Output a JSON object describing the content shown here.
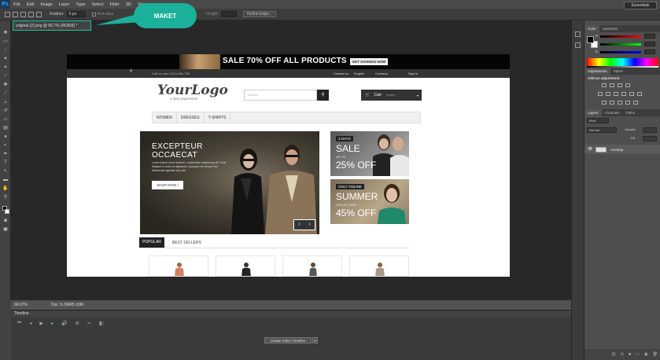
{
  "app": {
    "logo": "Ps"
  },
  "menu": [
    "File",
    "Edit",
    "Image",
    "Layer",
    "Type",
    "Select",
    "Filter",
    "3D",
    "View"
  ],
  "options": {
    "feather_label": "Feather:",
    "feather_value": "0 px",
    "antialias": "Anti-alias",
    "height_label": "Height:",
    "refine_button": "Refine Edge...",
    "workspace": "Essentials"
  },
  "document": {
    "tab_title": "original (2).png @ 66.7% (RGB/8) *",
    "zoom": "66.67%",
    "doc_size": "Doc: 5.29M/5.16M"
  },
  "annotation": {
    "label": "MAKET",
    "color": "#1ab09a"
  },
  "timeline": {
    "title": "Timeline",
    "create_button": "Create Video Timeline"
  },
  "panels": {
    "color_tabs": [
      "Color",
      "Swatches"
    ],
    "color_channels": [
      "R",
      "G",
      "B"
    ],
    "adjust_tabs": [
      "Adjustments",
      "Styles"
    ],
    "adjust_title": "Add an adjustment",
    "layer_tabs": [
      "Layers",
      "Channels",
      "Paths"
    ],
    "layer_kind": "Kind",
    "blend_mode": "Normal",
    "opacity_label": "Opacity:",
    "fill_label": "Fill:",
    "layer_name": "mockup"
  },
  "site": {
    "banner_text": "SALE 70% OFF ALL PRODUCTS",
    "banner_button": "GET SAVINGS NOW",
    "phone": "Call us now: 0123-456-789",
    "util": [
      "Contact us",
      "English",
      "Currency",
      "Sign in"
    ],
    "logo": "YourLogo",
    "logo_sub": "a new experience",
    "search_placeholder": "Search",
    "cart_label": "Cart",
    "cart_empty": "(empty)",
    "nav": [
      "WOMEN",
      "DRESSES",
      "T-SHIRTS"
    ],
    "hero_title_1": "EXCEPTEUR",
    "hero_title_2": "OCCAECAT",
    "hero_text": "Lorem ipsum dolor sit amet, consectetur adipiscing elit. Proin tristique in tortor et dignissim. Quisque non tempor leo. Maecenas egestas sem elit.",
    "hero_button": "SHOP NOW !",
    "promo1_badge": "3 DAYS",
    "promo1_big_1": "SALE",
    "promo1_small": "UP TO",
    "promo1_big_2": "25% OFF",
    "promo2_badge": "ONLY ONLINE",
    "promo2_big_1": "SUMMER",
    "promo2_small": "COLLECTION",
    "promo2_big_2": "45% OFF",
    "tab_popular": "POPULAR",
    "tab_best": "BEST SELLERS"
  }
}
